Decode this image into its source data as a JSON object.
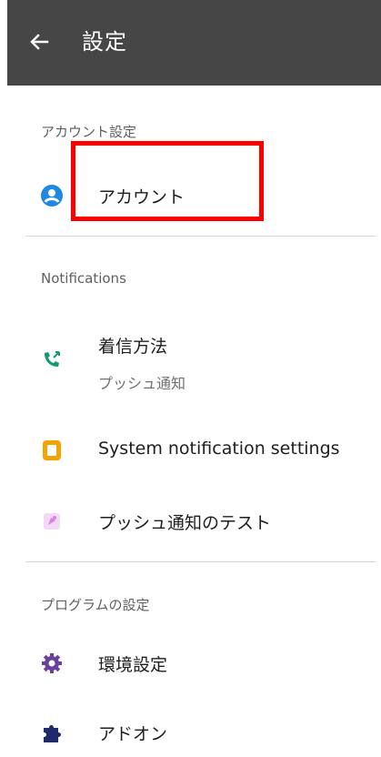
{
  "app_bar": {
    "title": "設定",
    "back_icon": "arrow-left-icon",
    "color": "#464646"
  },
  "sections": {
    "account": {
      "header": "アカウント設定",
      "items": [
        {
          "label": "アカウント",
          "icon": "account-circle-icon",
          "icon_color": "#1e88e5"
        }
      ]
    },
    "notifications": {
      "header": "Notifications",
      "items": [
        {
          "label": "着信方法",
          "sublabel": "プッシュ通知",
          "icon": "phone-incoming-icon",
          "icon_color": "#0f9a74"
        },
        {
          "label": "System notification settings",
          "icon": "notification-square-icon",
          "icon_color": "#f5a300"
        },
        {
          "label": "プッシュ通知のテスト",
          "icon": "push-test-icon",
          "icon_color": "#d77fe6"
        }
      ]
    },
    "program": {
      "header": "プログラムの設定",
      "items": [
        {
          "label": "環境設定",
          "icon": "gear-icon",
          "icon_color": "#6b3fa0"
        },
        {
          "label": "アドオン",
          "icon": "puzzle-icon",
          "icon_color": "#1f2a6b"
        }
      ]
    }
  },
  "highlight": {
    "color": "#ff0000",
    "target": "アカウント"
  }
}
